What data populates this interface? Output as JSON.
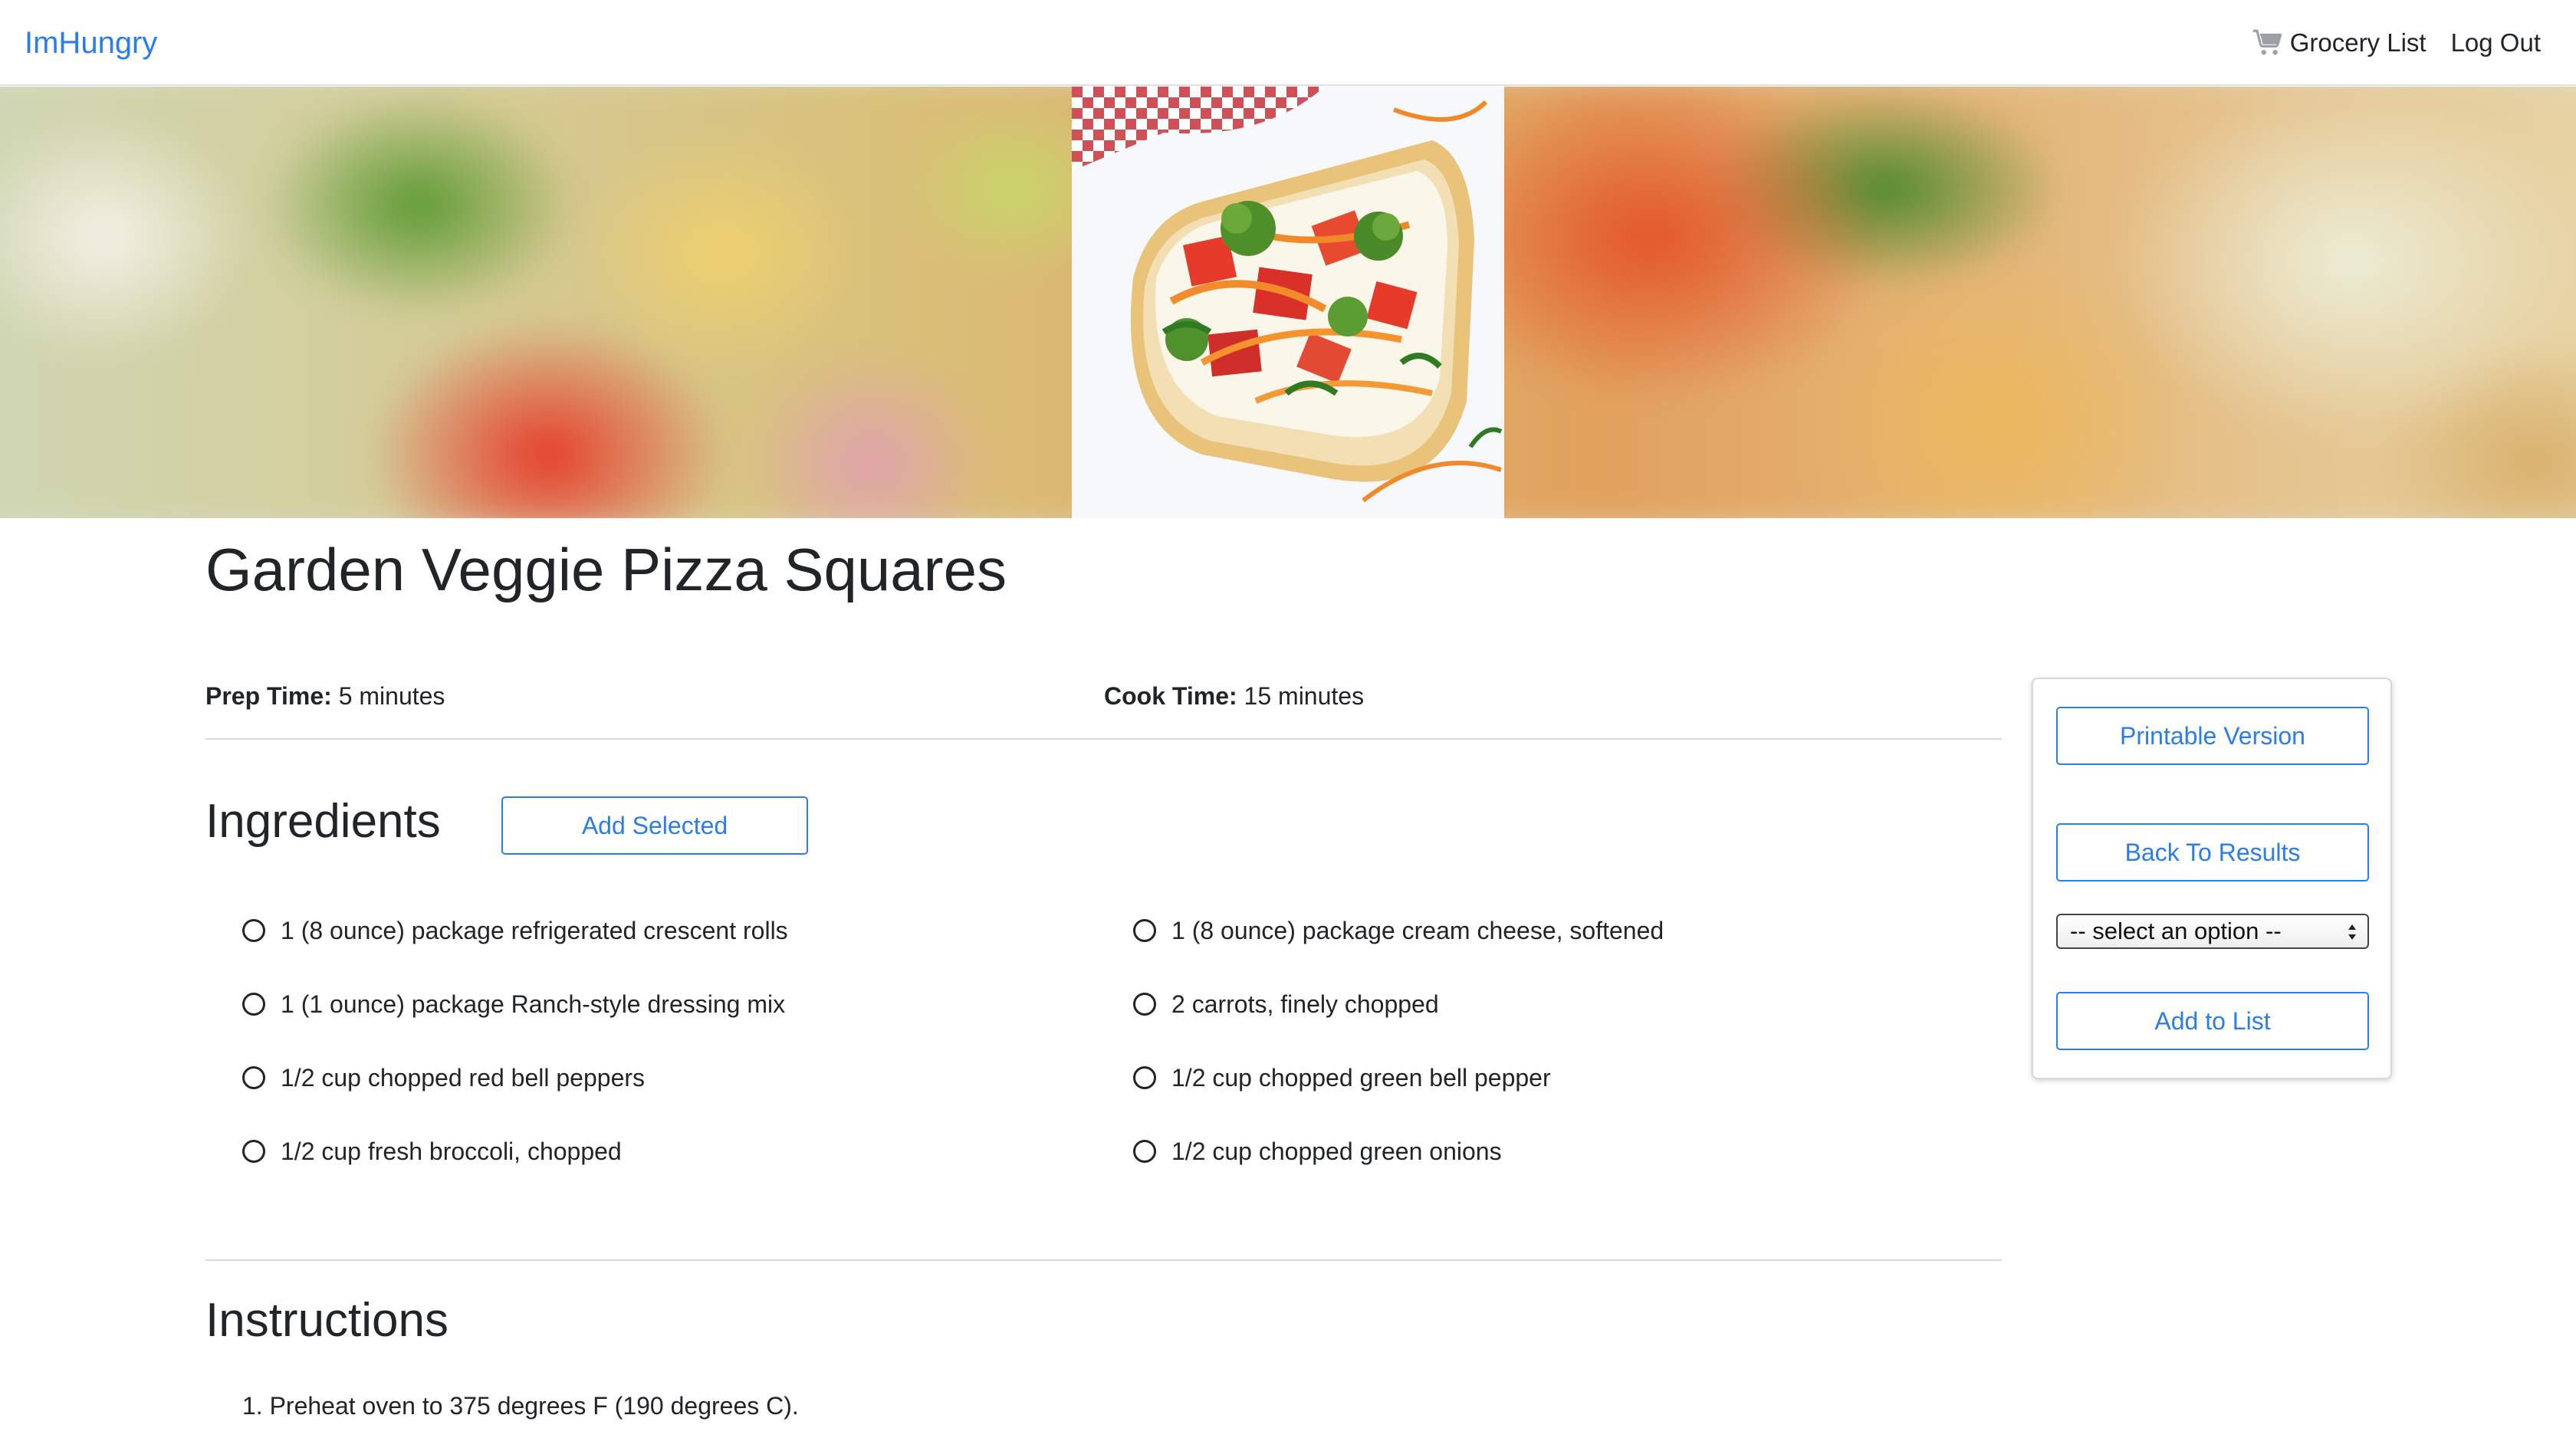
{
  "nav": {
    "brand": "ImHungry",
    "grocery_list": "Grocery List",
    "logout": "Log Out",
    "cart_icon": "cart-icon"
  },
  "recipe": {
    "title": "Garden Veggie Pizza Squares",
    "prep_label": "Prep Time:",
    "prep_value": "5 minutes",
    "cook_label": "Cook Time:",
    "cook_value": "15 minutes"
  },
  "ingredients": {
    "heading": "Ingredients",
    "add_selected_label": "Add Selected",
    "items": [
      "1 (8 ounce) package refrigerated crescent rolls",
      "1 (8 ounce) package cream cheese, softened",
      "1 (1 ounce) package Ranch-style dressing mix",
      "2 carrots, finely chopped",
      "1/2 cup chopped red bell peppers",
      "1/2 cup chopped green bell pepper",
      "1/2 cup fresh broccoli, chopped",
      "1/2 cup chopped green onions"
    ]
  },
  "instructions": {
    "heading": "Instructions",
    "steps": [
      "1. Preheat oven to 375 degrees F (190 degrees C)."
    ]
  },
  "sidebar": {
    "printable_label": "Printable Version",
    "back_label": "Back To Results",
    "select_value": "-- select an option --",
    "add_to_list_label": "Add to List"
  },
  "colors": {
    "accent": "#2b7de9",
    "text": "#212529",
    "divider": "#d6d8db"
  }
}
